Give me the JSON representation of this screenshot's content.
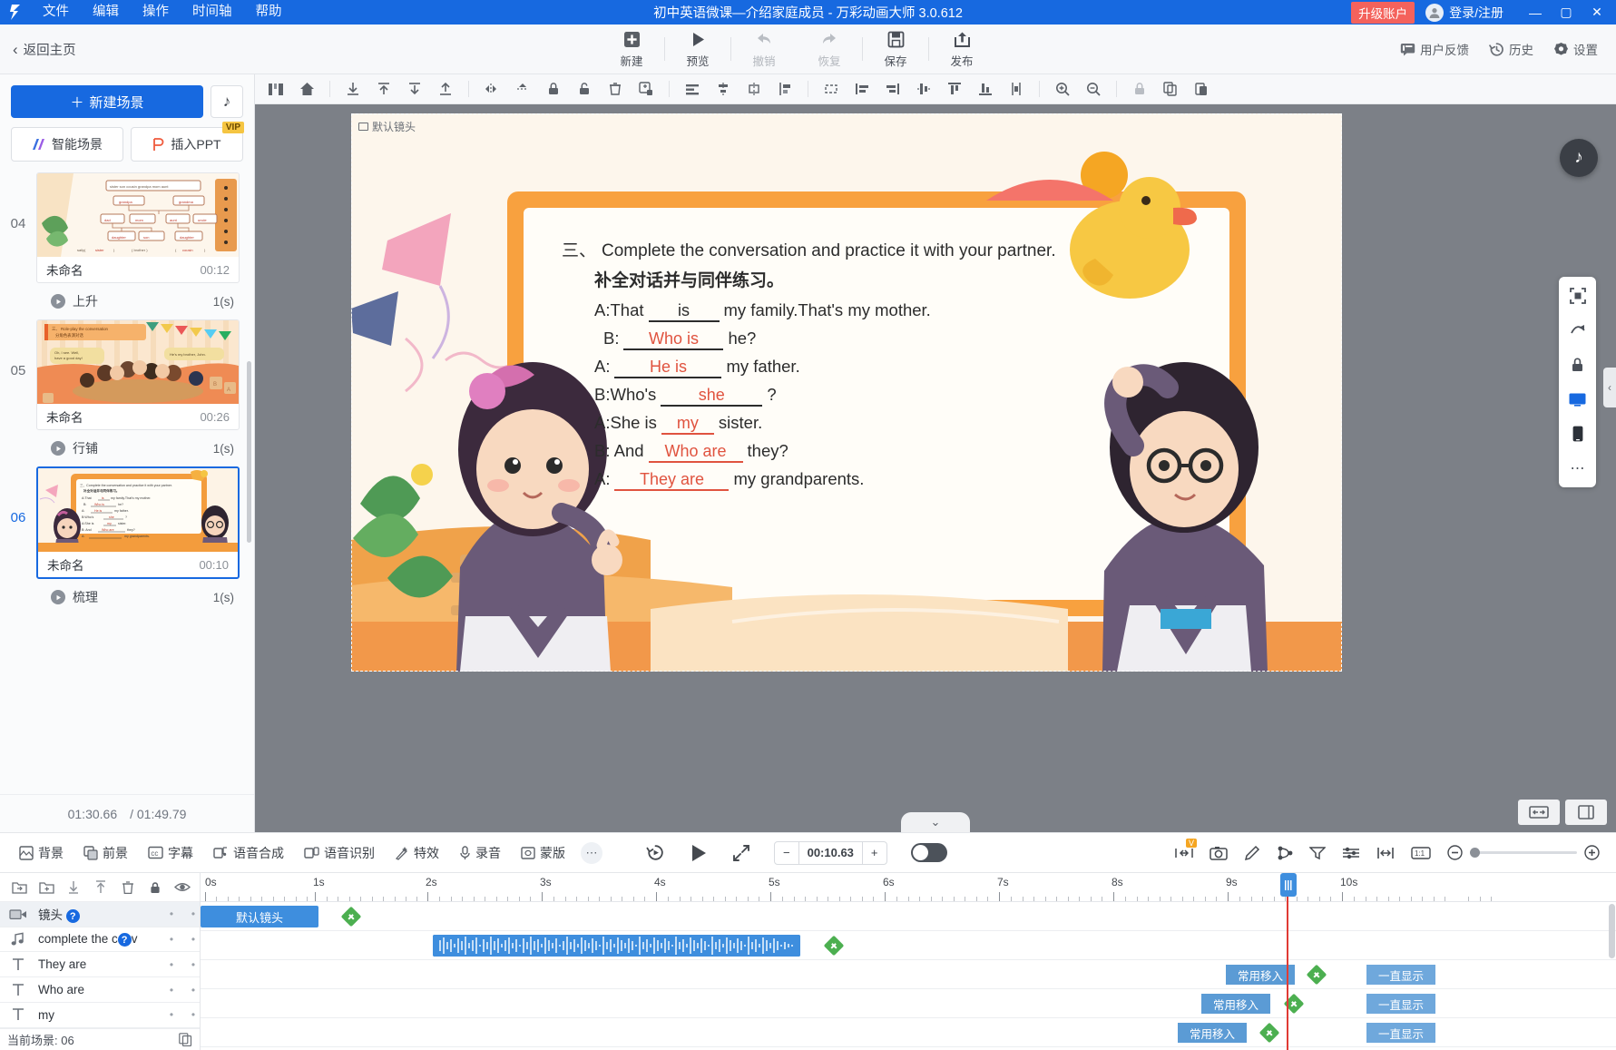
{
  "titlebar": {
    "menus": [
      "文件",
      "编辑",
      "操作",
      "时间轴",
      "帮助"
    ],
    "title": "初中英语微课—介绍家庭成员 - 万彩动画大师 3.0.612",
    "upgrade_label": "升级账户",
    "login_label": "登录/注册",
    "minimize": "—",
    "maximize": "▢",
    "close": "✕",
    "accent": "#1769e0",
    "upgrade_color": "#f4625c"
  },
  "header": {
    "back_label": "返回主页",
    "buttons": [
      {
        "label": "新建",
        "icon": "plus-square-icon",
        "disabled": false
      },
      {
        "label": "预览",
        "icon": "play-icon",
        "disabled": false
      },
      {
        "label": "撤销",
        "icon": "undo-arrow-icon",
        "disabled": true
      },
      {
        "label": "恢复",
        "icon": "redo-arrow-icon",
        "disabled": true
      },
      {
        "label": "保存",
        "icon": "save-disk-icon",
        "disabled": false
      },
      {
        "label": "发布",
        "icon": "upload-box-icon",
        "disabled": false
      }
    ],
    "right_items": [
      {
        "label": "用户反馈",
        "icon": "feedback-icon"
      },
      {
        "label": "历史",
        "icon": "history-clock-icon"
      },
      {
        "label": "设置",
        "icon": "gear-icon"
      }
    ]
  },
  "scene_panel": {
    "new_scene_label": "新建场景",
    "music_icon": "music-note-icon",
    "smart_scene_label": "智能场景",
    "insert_ppt_label": "插入PPT",
    "vip_tag": "VIP",
    "scenes": [
      {
        "number": "04",
        "name": "未命名",
        "duration": "00:12",
        "transition": "上升",
        "transition_duration": "1(s)",
        "active": false
      },
      {
        "number": "05",
        "name": "未命名",
        "duration": "00:26",
        "transition": "行铺",
        "transition_duration": "1(s)",
        "active": false
      },
      {
        "number": "06",
        "name": "未命名",
        "duration": "00:10",
        "transition": "梳理",
        "transition_duration": "1(s)",
        "active": true
      }
    ],
    "elapsed": "01:30.66",
    "total": "/ 01:49.79"
  },
  "stage": {
    "camera_label": "默认镜头",
    "toolbar_icons": [
      "timeline-grid-icon",
      "home-icon",
      "align-bottom-icon",
      "align-top-icon",
      "distribute-down-icon",
      "bring-up-icon",
      "flip-horizontal-icon",
      "flip-vertical-icon",
      "lock-icon",
      "unlock-icon",
      "delete-icon",
      "duplicate-icon",
      "align-left-icon",
      "align-center-h-icon",
      "align-right-icon",
      "align-justify-icon",
      "crop-icon",
      "distribute-left-icon",
      "distribute-right-icon",
      "align-middle-icon",
      "align-vtop-icon",
      "align-vbottom-icon",
      "distribute-v-icon",
      "zoom-in-icon",
      "zoom-out-icon",
      "lock2-icon",
      "copy-icon",
      "paste-icon"
    ],
    "dock_icons": [
      "fit-screen-icon",
      "flip-icon",
      "lock-icon",
      "desktop-icon",
      "mobile-icon",
      "more-icon"
    ],
    "music_float_icon": "music-note-icon"
  },
  "slide": {
    "heading_num": "三、",
    "heading_en": "Complete the conversation and practice it with your partner.",
    "heading_cn": "补全对话并与同伴练习。",
    "lines": [
      {
        "prefix": "A:That",
        "blank": "is",
        "suffix": "my family.That's my mother.",
        "blank_color": "#2c2c2c"
      },
      {
        "prefix": "B:",
        "blank": "Who is",
        "suffix": "he?",
        "blank_color": "#e0533f"
      },
      {
        "prefix": "A:",
        "blank": "He is",
        "suffix": "my father.",
        "blank_color": "#e0533f"
      },
      {
        "prefix": "B:Who's",
        "blank": "she",
        "suffix": "?",
        "blank_color": "#e0533f"
      },
      {
        "prefix": "A:She is",
        "blank": "my",
        "suffix": "sister.",
        "blank_color": "#e0533f"
      },
      {
        "prefix": "B: And",
        "blank": "Who are",
        "suffix": "they?",
        "blank_color": "#e0533f"
      },
      {
        "prefix": "A:",
        "blank": "They  are",
        "suffix": "my grandparents.",
        "blank_color": "#e0533f"
      }
    ]
  },
  "bottombar": {
    "items": [
      {
        "label": "背景",
        "icon": "background-icon"
      },
      {
        "label": "前景",
        "icon": "foreground-icon"
      },
      {
        "label": "字幕",
        "icon": "subtitle-cc-icon"
      },
      {
        "label": "语音合成",
        "icon": "tts-icon"
      },
      {
        "label": "语音识别",
        "icon": "asr-icon"
      },
      {
        "label": "特效",
        "icon": "effects-icon"
      },
      {
        "label": "录音",
        "icon": "microphone-icon"
      },
      {
        "label": "蒙版",
        "icon": "mask-icon"
      }
    ],
    "more_icon": "ellipsis-icon",
    "replay_icon": "replay-icon",
    "play_icon": "play-icon",
    "fullscreen_icon": "expand-icon",
    "minus": "−",
    "time_value": "00:10.63",
    "plus": "+",
    "right_icons": [
      "fit-width-icon",
      "camera-snapshot-icon",
      "edit-pen-icon",
      "branch-icon",
      "filter-icon",
      "settings-sliders-icon",
      "spacing-h-icon",
      "numbering-icon"
    ],
    "zoom_minus": "−",
    "zoom_plus": "+"
  },
  "timeline": {
    "tools": [
      "import-folder-icon",
      "new-folder-icon",
      "move-down-icon",
      "move-up-icon",
      "trash-icon",
      "lock-icon",
      "eye-icon"
    ],
    "tracks": [
      {
        "name": "镜头",
        "icon": "camera-icon",
        "has_qmark": true,
        "selected": true,
        "type": "camera"
      },
      {
        "name": "complete the conv",
        "icon": "audio-note-icon",
        "has_qmark": true,
        "selected": false,
        "type": "audio"
      },
      {
        "name": "They  are",
        "icon": "text-T-icon",
        "has_qmark": false,
        "selected": false,
        "type": "text"
      },
      {
        "name": "Who are",
        "icon": "text-T-icon",
        "has_qmark": false,
        "selected": false,
        "type": "text"
      },
      {
        "name": "my",
        "icon": "text-T-icon",
        "has_qmark": false,
        "selected": false,
        "type": "text"
      }
    ],
    "ruler_labels": [
      "0s",
      "1s",
      "2s",
      "3s",
      "4s",
      "5s",
      "6s",
      "7s",
      "8s",
      "9s",
      "10s"
    ],
    "camera_clip_label": "默认镜头",
    "enter_tag": "常用移入",
    "always_tag": "一直显示",
    "footer_label": "当前场景: 06",
    "footer_icon": "duplicate-scene-icon",
    "playhead_time": "9.6s"
  }
}
